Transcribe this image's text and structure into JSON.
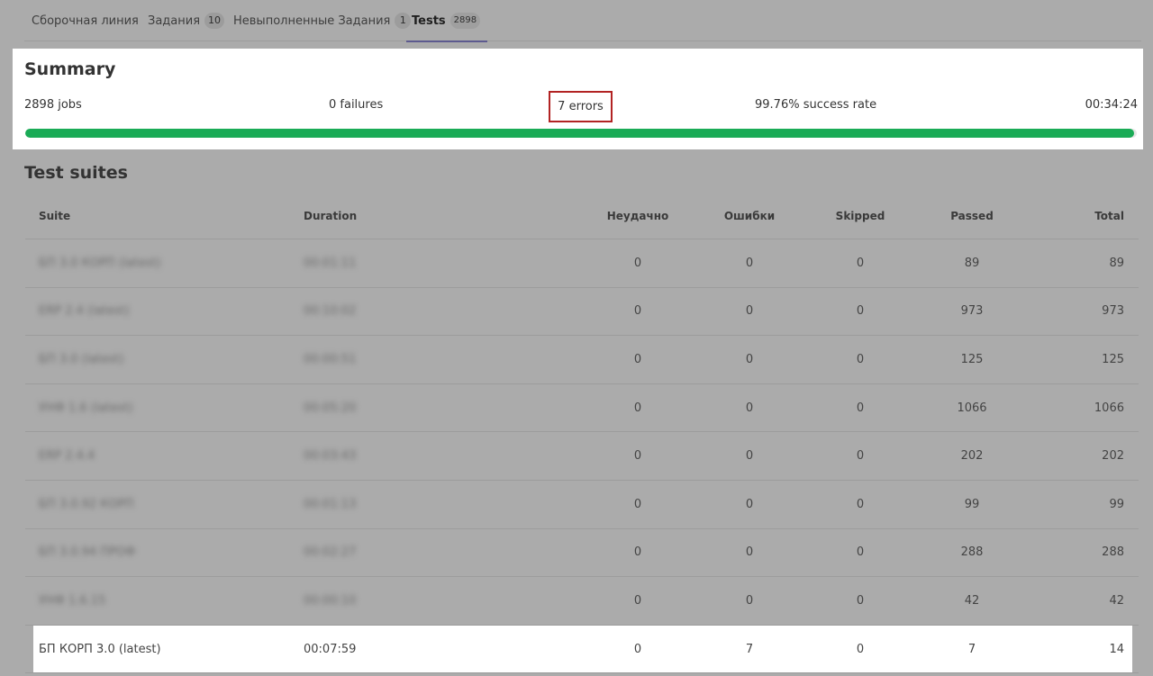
{
  "tabs": [
    {
      "label": "Сборочная линия",
      "count": ""
    },
    {
      "label": "Задания",
      "count": "10"
    },
    {
      "label": "Невыполненные Задания",
      "count": "1"
    },
    {
      "label": "Tests",
      "count": "2898"
    }
  ],
  "summary": {
    "title": "Summary",
    "jobs": "2898 jobs",
    "failures": "0 failures",
    "errors": "7 errors",
    "success_rate": "99.76% success rate",
    "duration": "00:34:24",
    "progress_percent": 99.76
  },
  "suites": {
    "title": "Test suites",
    "columns": [
      "Suite",
      "Duration",
      "Неудачно",
      "Ошибки",
      "Skipped",
      "Passed",
      "Total"
    ],
    "rows": [
      {
        "suite": "БП 3.0 КОРП (latest)",
        "duration": "00:01:11",
        "failed": "0",
        "errors": "0",
        "skipped": "0",
        "passed": "89",
        "total": "89"
      },
      {
        "suite": "ERP 2.4 (latest)",
        "duration": "00:10:02",
        "failed": "0",
        "errors": "0",
        "skipped": "0",
        "passed": "973",
        "total": "973"
      },
      {
        "suite": "БП 3.0 (latest)",
        "duration": "00:00:51",
        "failed": "0",
        "errors": "0",
        "skipped": "0",
        "passed": "125",
        "total": "125"
      },
      {
        "suite": "УНФ 1.6 (latest)",
        "duration": "00:05:20",
        "failed": "0",
        "errors": "0",
        "skipped": "0",
        "passed": "1066",
        "total": "1066"
      },
      {
        "suite": "ERP 2.4.4",
        "duration": "00:03:43",
        "failed": "0",
        "errors": "0",
        "skipped": "0",
        "passed": "202",
        "total": "202"
      },
      {
        "suite": "БП 3.0.92 КОРП",
        "duration": "00:01:13",
        "failed": "0",
        "errors": "0",
        "skipped": "0",
        "passed": "99",
        "total": "99"
      },
      {
        "suite": "БП 3.0.94 ПРОФ",
        "duration": "00:02:27",
        "failed": "0",
        "errors": "0",
        "skipped": "0",
        "passed": "288",
        "total": "288"
      },
      {
        "suite": "УНФ 1.6.15",
        "duration": "00:00:10",
        "failed": "0",
        "errors": "0",
        "skipped": "0",
        "passed": "42",
        "total": "42"
      },
      {
        "suite": "БП КОРП 3.0 (latest)",
        "duration": "00:07:59",
        "failed": "0",
        "errors": "7",
        "skipped": "0",
        "passed": "7",
        "total": "14"
      }
    ]
  }
}
